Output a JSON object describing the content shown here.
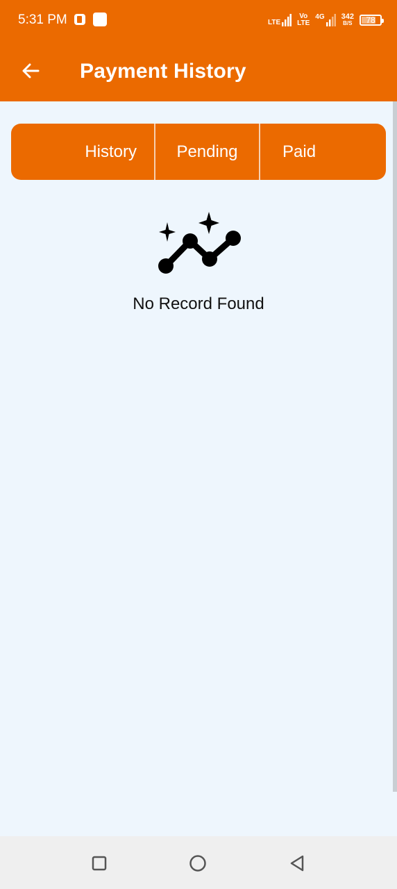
{
  "status_bar": {
    "time": "5:31 PM",
    "network_1": "LTE",
    "network_2_top": "Vo",
    "network_2_bottom": "LTE",
    "network_3": "4G",
    "speed_value": "342",
    "speed_unit": "B/S",
    "battery_level": "78",
    "icons": [
      "notification-app-icon",
      "notification-square-icon",
      "signal-icon",
      "signal-icon",
      "battery-icon"
    ]
  },
  "app_bar": {
    "title": "Payment History",
    "back_icon": "arrow-left-icon",
    "color": "#EB6A00"
  },
  "tabs": [
    {
      "label": "History"
    },
    {
      "label": "Pending"
    },
    {
      "label": "Paid"
    }
  ],
  "empty_state": {
    "icon": "trending-sparkle-icon",
    "message": "No Record Found"
  },
  "nav_bar": {
    "icons": [
      "recents-square-icon",
      "home-circle-icon",
      "back-triangle-icon"
    ]
  },
  "colors": {
    "accent": "#EB6A00",
    "background": "#EEF6FD"
  }
}
